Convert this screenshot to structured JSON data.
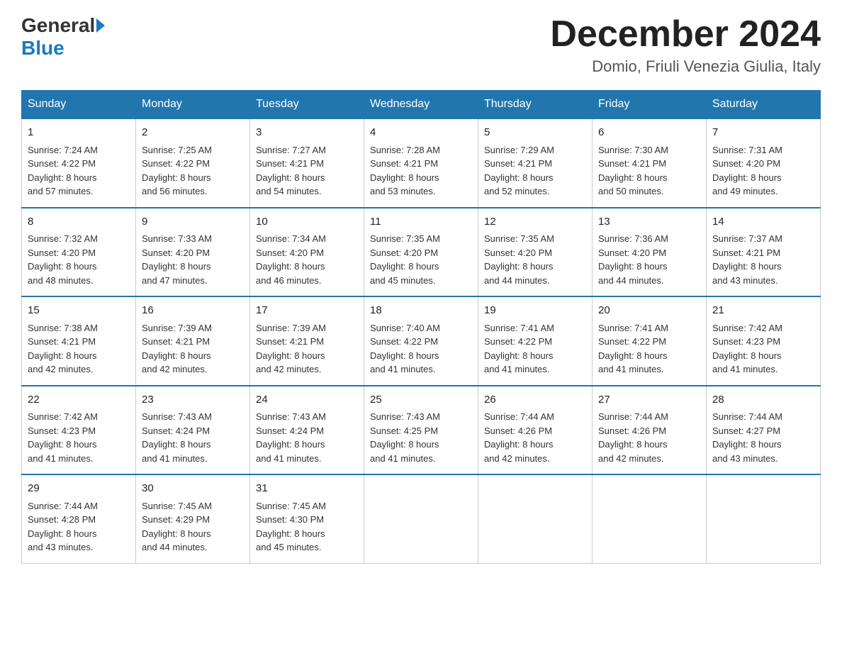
{
  "header": {
    "logo_general": "General",
    "logo_blue": "Blue",
    "month_year": "December 2024",
    "location": "Domio, Friuli Venezia Giulia, Italy"
  },
  "days_of_week": [
    "Sunday",
    "Monday",
    "Tuesday",
    "Wednesday",
    "Thursday",
    "Friday",
    "Saturday"
  ],
  "weeks": [
    [
      {
        "day": "1",
        "sunrise": "7:24 AM",
        "sunset": "4:22 PM",
        "daylight": "8 hours and 57 minutes."
      },
      {
        "day": "2",
        "sunrise": "7:25 AM",
        "sunset": "4:22 PM",
        "daylight": "8 hours and 56 minutes."
      },
      {
        "day": "3",
        "sunrise": "7:27 AM",
        "sunset": "4:21 PM",
        "daylight": "8 hours and 54 minutes."
      },
      {
        "day": "4",
        "sunrise": "7:28 AM",
        "sunset": "4:21 PM",
        "daylight": "8 hours and 53 minutes."
      },
      {
        "day": "5",
        "sunrise": "7:29 AM",
        "sunset": "4:21 PM",
        "daylight": "8 hours and 52 minutes."
      },
      {
        "day": "6",
        "sunrise": "7:30 AM",
        "sunset": "4:21 PM",
        "daylight": "8 hours and 50 minutes."
      },
      {
        "day": "7",
        "sunrise": "7:31 AM",
        "sunset": "4:20 PM",
        "daylight": "8 hours and 49 minutes."
      }
    ],
    [
      {
        "day": "8",
        "sunrise": "7:32 AM",
        "sunset": "4:20 PM",
        "daylight": "8 hours and 48 minutes."
      },
      {
        "day": "9",
        "sunrise": "7:33 AM",
        "sunset": "4:20 PM",
        "daylight": "8 hours and 47 minutes."
      },
      {
        "day": "10",
        "sunrise": "7:34 AM",
        "sunset": "4:20 PM",
        "daylight": "8 hours and 46 minutes."
      },
      {
        "day": "11",
        "sunrise": "7:35 AM",
        "sunset": "4:20 PM",
        "daylight": "8 hours and 45 minutes."
      },
      {
        "day": "12",
        "sunrise": "7:35 AM",
        "sunset": "4:20 PM",
        "daylight": "8 hours and 44 minutes."
      },
      {
        "day": "13",
        "sunrise": "7:36 AM",
        "sunset": "4:20 PM",
        "daylight": "8 hours and 44 minutes."
      },
      {
        "day": "14",
        "sunrise": "7:37 AM",
        "sunset": "4:21 PM",
        "daylight": "8 hours and 43 minutes."
      }
    ],
    [
      {
        "day": "15",
        "sunrise": "7:38 AM",
        "sunset": "4:21 PM",
        "daylight": "8 hours and 42 minutes."
      },
      {
        "day": "16",
        "sunrise": "7:39 AM",
        "sunset": "4:21 PM",
        "daylight": "8 hours and 42 minutes."
      },
      {
        "day": "17",
        "sunrise": "7:39 AM",
        "sunset": "4:21 PM",
        "daylight": "8 hours and 42 minutes."
      },
      {
        "day": "18",
        "sunrise": "7:40 AM",
        "sunset": "4:22 PM",
        "daylight": "8 hours and 41 minutes."
      },
      {
        "day": "19",
        "sunrise": "7:41 AM",
        "sunset": "4:22 PM",
        "daylight": "8 hours and 41 minutes."
      },
      {
        "day": "20",
        "sunrise": "7:41 AM",
        "sunset": "4:22 PM",
        "daylight": "8 hours and 41 minutes."
      },
      {
        "day": "21",
        "sunrise": "7:42 AM",
        "sunset": "4:23 PM",
        "daylight": "8 hours and 41 minutes."
      }
    ],
    [
      {
        "day": "22",
        "sunrise": "7:42 AM",
        "sunset": "4:23 PM",
        "daylight": "8 hours and 41 minutes."
      },
      {
        "day": "23",
        "sunrise": "7:43 AM",
        "sunset": "4:24 PM",
        "daylight": "8 hours and 41 minutes."
      },
      {
        "day": "24",
        "sunrise": "7:43 AM",
        "sunset": "4:24 PM",
        "daylight": "8 hours and 41 minutes."
      },
      {
        "day": "25",
        "sunrise": "7:43 AM",
        "sunset": "4:25 PM",
        "daylight": "8 hours and 41 minutes."
      },
      {
        "day": "26",
        "sunrise": "7:44 AM",
        "sunset": "4:26 PM",
        "daylight": "8 hours and 42 minutes."
      },
      {
        "day": "27",
        "sunrise": "7:44 AM",
        "sunset": "4:26 PM",
        "daylight": "8 hours and 42 minutes."
      },
      {
        "day": "28",
        "sunrise": "7:44 AM",
        "sunset": "4:27 PM",
        "daylight": "8 hours and 43 minutes."
      }
    ],
    [
      {
        "day": "29",
        "sunrise": "7:44 AM",
        "sunset": "4:28 PM",
        "daylight": "8 hours and 43 minutes."
      },
      {
        "day": "30",
        "sunrise": "7:45 AM",
        "sunset": "4:29 PM",
        "daylight": "8 hours and 44 minutes."
      },
      {
        "day": "31",
        "sunrise": "7:45 AM",
        "sunset": "4:30 PM",
        "daylight": "8 hours and 45 minutes."
      },
      null,
      null,
      null,
      null
    ]
  ],
  "labels": {
    "sunrise": "Sunrise:",
    "sunset": "Sunset:",
    "daylight": "Daylight:"
  }
}
